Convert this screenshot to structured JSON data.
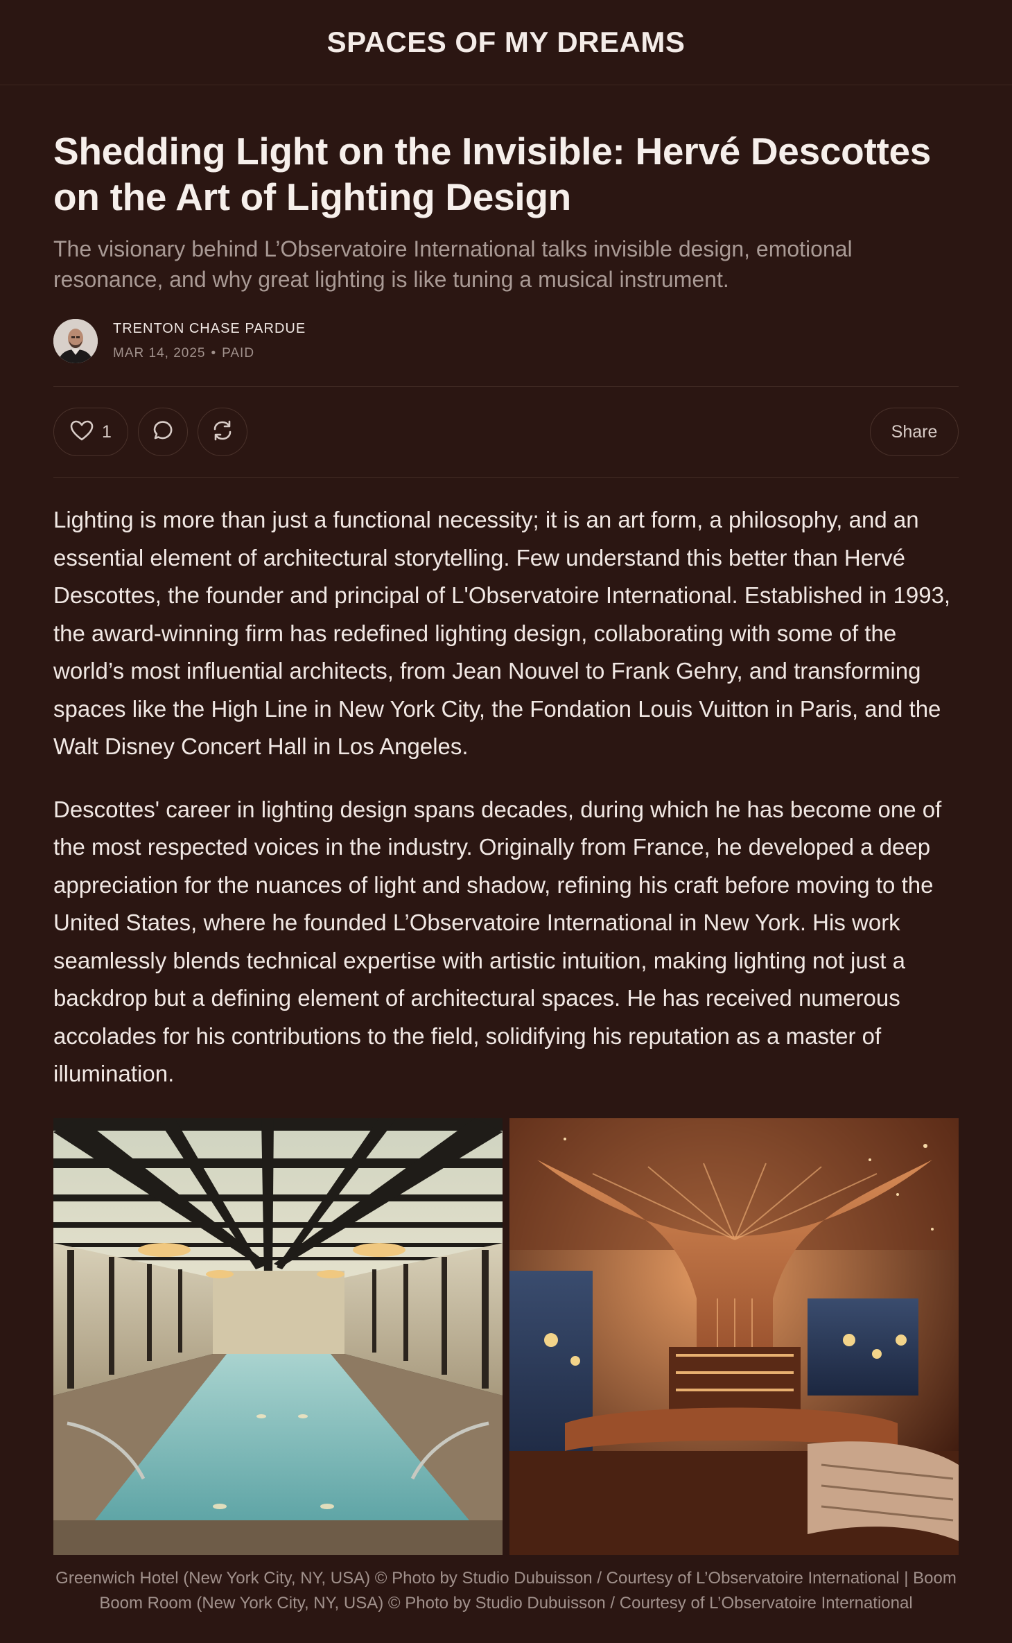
{
  "header": {
    "publication_title": "SPACES OF MY DREAMS"
  },
  "article": {
    "title": "Shedding Light on the Invisible: Hervé Descottes on the Art of Lighting Design",
    "subtitle": "The visionary behind L’Observatoire International talks invisible design, emotional resonance, and why great lighting is like tuning a musical instrument.",
    "author": "TRENTON CHASE PARDUE",
    "date": "MAR 14, 2025",
    "separator": "•",
    "access": "PAID",
    "paragraphs": [
      "Lighting is more than just a functional necessity; it is an art form, a philosophy, and an essential element of architectural storytelling. Few understand this better than Hervé Descottes, the founder and principal of L'Observatoire International. Established in 1993, the award-winning firm has redefined lighting design, collaborating with some of the world’s most influential architects, from Jean Nouvel to Frank Gehry, and transforming spaces like the High Line in New York City, the Fondation Louis Vuitton in Paris, and the Walt Disney Concert Hall in Los Angeles.",
      "Descottes' career in lighting design spans decades, during which he has become one of the most respected voices in the industry. Originally from France, he developed a deep appreciation for the nuances of light and shadow, refining his craft before moving to the United States, where he founded L’Observatoire International in New York. His work seamlessly blends technical expertise with artistic intuition, making lighting not just a backdrop but a defining element of architectural spaces. He has received numerous accolades for his contributions to the field, solidifying his reputation as a master of illumination."
    ],
    "caption": "Greenwich Hotel (New York City, NY, USA) © Photo by Studio Dubuisson / Courtesy of L’Observatoire International | Boom Boom Room (New York City, NY, USA) © Photo by Studio Dubuisson / Courtesy of L’Observatoire International"
  },
  "actions": {
    "like_count": "1",
    "share_label": "Share",
    "icons": [
      "heart-icon",
      "comment-icon",
      "restack-icon"
    ]
  },
  "colors": {
    "background": "#2b1612",
    "text": "#f2e8e4",
    "muted": "#a99a95",
    "border": "#4a322b"
  }
}
